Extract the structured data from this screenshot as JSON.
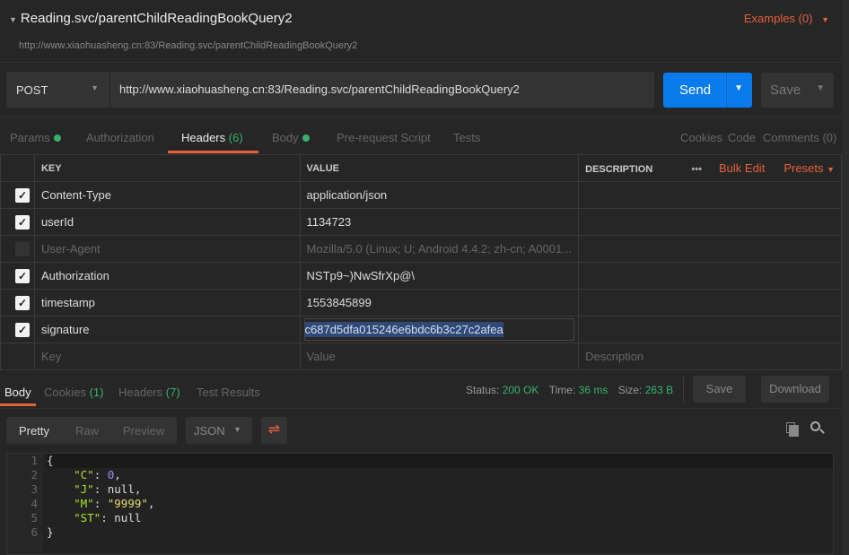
{
  "request": {
    "name": "Reading.svc/parentChildReadingBookQuery2",
    "examples": "Examples (0)",
    "url_display": "http://www.xiaohuasheng.cn:83/Reading.svc/parentChildReadingBookQuery2",
    "method": "POST",
    "url": "http://www.xiaohuasheng.cn:83/Reading.svc/parentChildReadingBookQuery2",
    "send": "Send",
    "save": "Save"
  },
  "tabs": {
    "params": "Params",
    "authorization": "Authorization",
    "headers": "Headers",
    "headers_count": "(6)",
    "body": "Body",
    "prerequest": "Pre-request Script",
    "tests": "Tests",
    "cookies": "Cookies",
    "code": "Code",
    "comments": "Comments (0)"
  },
  "headers_table": {
    "col_key": "KEY",
    "col_value": "VALUE",
    "col_desc": "DESCRIPTION",
    "more": "•••",
    "bulk_edit": "Bulk Edit",
    "presets": "Presets",
    "rows": [
      {
        "checked": true,
        "key": "Content-Type",
        "value": "application/json"
      },
      {
        "checked": true,
        "key": "userId",
        "value": "1134723"
      },
      {
        "checked": false,
        "key": "User-Agent",
        "value": "Mozilla/5.0 (Linux; U; Android 4.4.2; zh-cn; A0001..."
      },
      {
        "checked": true,
        "key": "Authorization",
        "value": "NSTp9~)NwSfrXp@\\"
      },
      {
        "checked": true,
        "key": "timestamp",
        "value": "1553845899"
      },
      {
        "checked": true,
        "key": "signature",
        "value": "c687d5dfa015246e6bdc6b3c27c2afea"
      }
    ],
    "placeholder_key": "Key",
    "placeholder_value": "Value",
    "placeholder_desc": "Description"
  },
  "response": {
    "tabs": {
      "body": "Body",
      "cookies": "Cookies",
      "cookies_count": "(1)",
      "headers": "Headers",
      "headers_count": "(7)",
      "test_results": "Test Results"
    },
    "status_label": "Status:",
    "status": "200 OK",
    "time_label": "Time:",
    "time": "36 ms",
    "size_label": "Size:",
    "size": "263 B",
    "save": "Save",
    "download": "Download",
    "formats": [
      "Pretty",
      "Raw",
      "Preview"
    ],
    "language": "JSON",
    "lines": [
      "1",
      "2",
      "3",
      "4",
      "5",
      "6"
    ],
    "code": {
      "open": "{",
      "c_key": "\"C\"",
      "c_val": "0",
      "j_key": "\"J\"",
      "j_val": "null",
      "m_key": "\"M\"",
      "m_val": "\"9999\"",
      "st_key": "\"ST\"",
      "st_val": "null",
      "close": "}"
    }
  },
  "colors": {
    "accent": "#e4613c",
    "send": "#097bed",
    "success": "#38b26b"
  }
}
